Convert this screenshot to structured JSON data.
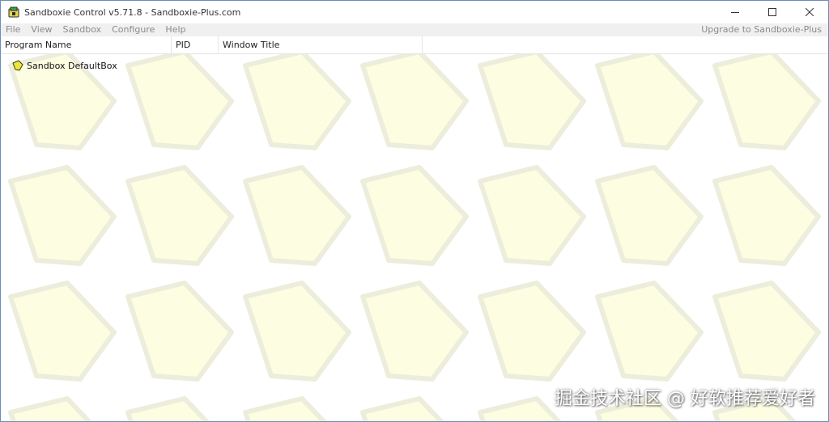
{
  "window": {
    "title": "Sandboxie Control v5.71.8 - Sandboxie-Plus.com"
  },
  "menu": {
    "items": [
      {
        "label": "File"
      },
      {
        "label": "View"
      },
      {
        "label": "Sandbox"
      },
      {
        "label": "Configure"
      },
      {
        "label": "Help"
      }
    ],
    "upgrade_label": "Upgrade to Sandboxie-Plus"
  },
  "table": {
    "columns": [
      {
        "label": "Program Name"
      },
      {
        "label": "PID"
      },
      {
        "label": "Window Title"
      }
    ],
    "rows": [
      {
        "label": "Sandbox DefaultBox"
      }
    ]
  },
  "watermark": {
    "text": "掘金技术社区 @ 好软推荐爱好者"
  },
  "colors": {
    "window_border": "#6b8fb8",
    "menubar_bg": "#f0f0f0",
    "menu_text": "#8a8a8a",
    "pattern_fill": "#fdfde2",
    "pattern_stroke": "#ededdc",
    "sandbox_icon": "#e8e83a"
  },
  "icons": {
    "app": "sandboxie-app-icon",
    "minimize": "minimize-icon",
    "maximize": "maximize-icon",
    "close": "close-icon",
    "sandbox": "sandbox-diamond-icon"
  }
}
